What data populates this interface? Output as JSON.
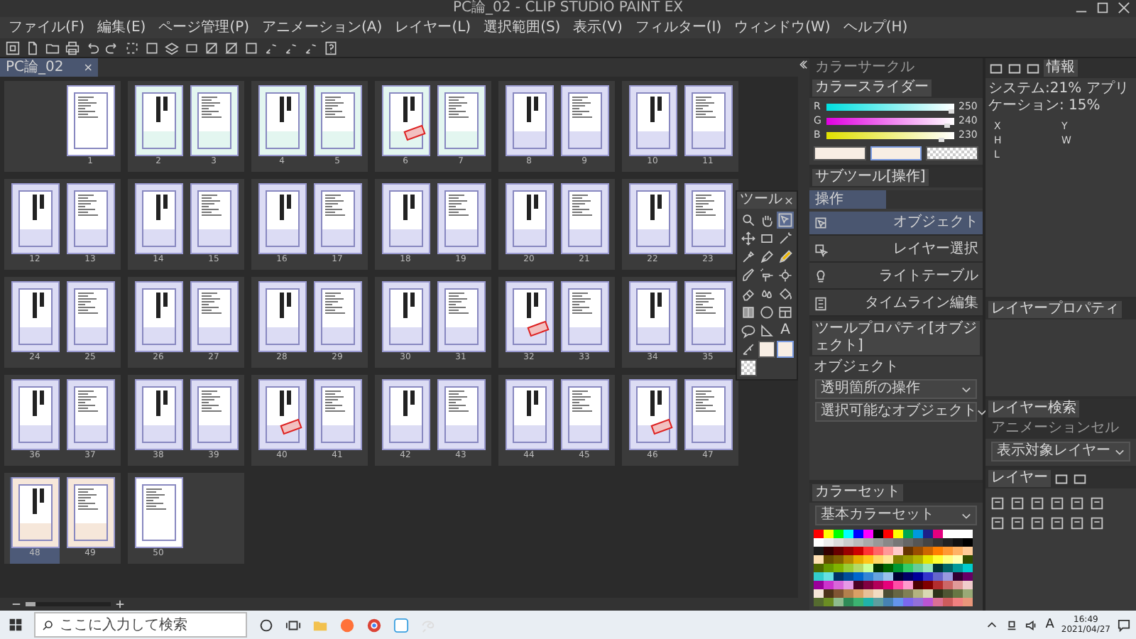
{
  "window": {
    "title": "PC論_02 - CLIP STUDIO PAINT EX"
  },
  "menu": [
    "ファイル(F)",
    "編集(E)",
    "ページ管理(P)",
    "アニメーション(A)",
    "レイヤー(L)",
    "選択範囲(S)",
    "表示(V)",
    "フィルター(I)",
    "ウィンドウ(W)",
    "ヘルプ(H)"
  ],
  "document_tab": {
    "label": "PC論_02",
    "close": "×"
  },
  "spreads": [
    {
      "pages": [
        {
          "number": "1",
          "kind": "text",
          "color": "#ffffff",
          "stamped": false,
          "selected": false
        }
      ]
    },
    {
      "pages": [
        {
          "number": "2",
          "kind": "name",
          "color": "#e3f6f0",
          "stamped": false,
          "selected": false
        },
        {
          "number": "3",
          "kind": "text",
          "color": "#e3f6f0",
          "stamped": false,
          "selected": false
        }
      ]
    },
    {
      "pages": [
        {
          "number": "4",
          "kind": "name",
          "color": "#e3f6f0",
          "stamped": false,
          "selected": false
        },
        {
          "number": "5",
          "kind": "text",
          "color": "#e3f6f0",
          "stamped": false,
          "selected": false
        }
      ]
    },
    {
      "pages": [
        {
          "number": "6",
          "kind": "name",
          "color": "#e3f6f0",
          "stamped": true,
          "selected": false
        },
        {
          "number": "7",
          "kind": "text",
          "color": "#e3f6f0",
          "stamped": false,
          "selected": false
        }
      ]
    },
    {
      "pages": [
        {
          "number": "8",
          "kind": "name",
          "color": "#dcdcf4",
          "stamped": false,
          "selected": false
        },
        {
          "number": "9",
          "kind": "text",
          "color": "#dcdcf4",
          "stamped": false,
          "selected": false
        }
      ]
    },
    {
      "pages": [
        {
          "number": "10",
          "kind": "name",
          "color": "#dcdcf4",
          "stamped": false,
          "selected": false
        },
        {
          "number": "11",
          "kind": "text",
          "color": "#dcdcf4",
          "stamped": false,
          "selected": false
        }
      ]
    },
    {
      "pages": [
        {
          "number": "12",
          "kind": "name",
          "color": "#dcdcf4",
          "stamped": false,
          "selected": false
        },
        {
          "number": "13",
          "kind": "text",
          "color": "#dcdcf4",
          "stamped": false,
          "selected": false
        }
      ]
    },
    {
      "pages": [
        {
          "number": "14",
          "kind": "name",
          "color": "#dcdcf4",
          "stamped": false,
          "selected": false
        },
        {
          "number": "15",
          "kind": "text",
          "color": "#dcdcf4",
          "stamped": false,
          "selected": false
        }
      ]
    },
    {
      "pages": [
        {
          "number": "16",
          "kind": "name",
          "color": "#dcdcf4",
          "stamped": false,
          "selected": false
        },
        {
          "number": "17",
          "kind": "text",
          "color": "#dcdcf4",
          "stamped": false,
          "selected": false
        }
      ]
    },
    {
      "pages": [
        {
          "number": "18",
          "kind": "name",
          "color": "#dcdcf4",
          "stamped": false,
          "selected": false
        },
        {
          "number": "19",
          "kind": "text",
          "color": "#dcdcf4",
          "stamped": false,
          "selected": false
        }
      ]
    },
    {
      "pages": [
        {
          "number": "20",
          "kind": "name",
          "color": "#dcdcf4",
          "stamped": false,
          "selected": false
        },
        {
          "number": "21",
          "kind": "text",
          "color": "#dcdcf4",
          "stamped": false,
          "selected": false
        }
      ]
    },
    {
      "pages": [
        {
          "number": "22",
          "kind": "name",
          "color": "#dcdcf4",
          "stamped": false,
          "selected": false
        },
        {
          "number": "23",
          "kind": "text",
          "color": "#dcdcf4",
          "stamped": false,
          "selected": false
        }
      ]
    },
    {
      "pages": [
        {
          "number": "24",
          "kind": "name",
          "color": "#dcdcf4",
          "stamped": false,
          "selected": false
        },
        {
          "number": "25",
          "kind": "text",
          "color": "#dcdcf4",
          "stamped": false,
          "selected": false
        }
      ]
    },
    {
      "pages": [
        {
          "number": "26",
          "kind": "name",
          "color": "#dcdcf4",
          "stamped": false,
          "selected": false
        },
        {
          "number": "27",
          "kind": "text",
          "color": "#dcdcf4",
          "stamped": false,
          "selected": false
        }
      ]
    },
    {
      "pages": [
        {
          "number": "28",
          "kind": "name",
          "color": "#dcdcf4",
          "stamped": false,
          "selected": false
        },
        {
          "number": "29",
          "kind": "text",
          "color": "#dcdcf4",
          "stamped": false,
          "selected": false
        }
      ]
    },
    {
      "pages": [
        {
          "number": "30",
          "kind": "name",
          "color": "#dcdcf4",
          "stamped": false,
          "selected": false
        },
        {
          "number": "31",
          "kind": "text",
          "color": "#dcdcf4",
          "stamped": false,
          "selected": false
        }
      ]
    },
    {
      "pages": [
        {
          "number": "32",
          "kind": "name",
          "color": "#dcdcf4",
          "stamped": true,
          "selected": false
        },
        {
          "number": "33",
          "kind": "text",
          "color": "#dcdcf4",
          "stamped": false,
          "selected": false
        }
      ]
    },
    {
      "pages": [
        {
          "number": "34",
          "kind": "name",
          "color": "#dcdcf4",
          "stamped": false,
          "selected": false
        },
        {
          "number": "35",
          "kind": "text",
          "color": "#dcdcf4",
          "stamped": false,
          "selected": false
        }
      ]
    },
    {
      "pages": [
        {
          "number": "36",
          "kind": "name",
          "color": "#dcdcf4",
          "stamped": false,
          "selected": false
        },
        {
          "number": "37",
          "kind": "text",
          "color": "#dcdcf4",
          "stamped": false,
          "selected": false
        }
      ]
    },
    {
      "pages": [
        {
          "number": "38",
          "kind": "name",
          "color": "#dcdcf4",
          "stamped": false,
          "selected": false
        },
        {
          "number": "39",
          "kind": "text",
          "color": "#dcdcf4",
          "stamped": false,
          "selected": false
        }
      ]
    },
    {
      "pages": [
        {
          "number": "40",
          "kind": "name",
          "color": "#dcdcf4",
          "stamped": true,
          "selected": false
        },
        {
          "number": "41",
          "kind": "text",
          "color": "#dcdcf4",
          "stamped": false,
          "selected": false
        }
      ]
    },
    {
      "pages": [
        {
          "number": "42",
          "kind": "name",
          "color": "#dcdcf4",
          "stamped": false,
          "selected": false
        },
        {
          "number": "43",
          "kind": "text",
          "color": "#dcdcf4",
          "stamped": false,
          "selected": false
        }
      ]
    },
    {
      "pages": [
        {
          "number": "44",
          "kind": "name",
          "color": "#dcdcf4",
          "stamped": false,
          "selected": false
        },
        {
          "number": "45",
          "kind": "text",
          "color": "#dcdcf4",
          "stamped": false,
          "selected": false
        }
      ]
    },
    {
      "pages": [
        {
          "number": "46",
          "kind": "name",
          "color": "#dcdcf4",
          "stamped": true,
          "selected": false
        },
        {
          "number": "47",
          "kind": "text",
          "color": "#dcdcf4",
          "stamped": false,
          "selected": false
        }
      ]
    },
    {
      "pages": [
        {
          "number": "48",
          "kind": "name",
          "color": "#f6e7da",
          "stamped": false,
          "selected": true
        },
        {
          "number": "49",
          "kind": "text",
          "color": "#f6e7da",
          "stamped": false,
          "selected": false
        }
      ]
    },
    {
      "pages": [
        {
          "number": "50",
          "kind": "text",
          "color": "#ffffff",
          "stamped": false,
          "selected": false
        }
      ]
    }
  ],
  "tool_palette": {
    "title": "ツール",
    "tools": [
      {
        "kind": "magnifier",
        "selected": false
      },
      {
        "kind": "hand",
        "selected": false
      },
      {
        "kind": "pointer-box",
        "selected": true
      },
      {
        "kind": "move-cross",
        "selected": false
      },
      {
        "kind": "rectangle",
        "selected": false
      },
      {
        "kind": "wand",
        "selected": false
      },
      {
        "kind": "eyedropper",
        "selected": false
      },
      {
        "kind": "pen",
        "selected": false
      },
      {
        "kind": "pencil",
        "selected": false
      },
      {
        "kind": "brush",
        "selected": false
      },
      {
        "kind": "airbrush",
        "selected": false
      },
      {
        "kind": "gear",
        "selected": false
      },
      {
        "kind": "eraser",
        "selected": false
      },
      {
        "kind": "drops",
        "selected": false
      },
      {
        "kind": "bucket",
        "selected": false
      },
      {
        "kind": "gradient",
        "selected": false
      },
      {
        "kind": "circle",
        "selected": false
      },
      {
        "kind": "frame",
        "selected": false
      },
      {
        "kind": "bubble",
        "selected": false
      },
      {
        "kind": "ruler",
        "selected": false
      },
      {
        "kind": "text",
        "label": "A",
        "selected": false
      },
      {
        "kind": "line-fix",
        "selected": false
      }
    ],
    "swatches": [
      {
        "kind": "color",
        "color": "#f8eee4",
        "selected": false
      },
      {
        "kind": "color",
        "color": "#f8eee4",
        "selected": true
      },
      {
        "kind": "transparent",
        "selected": false
      }
    ]
  },
  "zoom_slider": {
    "level": 0.12
  },
  "color_panel": {
    "tabs": [
      {
        "label": "カラーサークル",
        "selected": false
      },
      {
        "label": "カラースライダー",
        "selected": true
      }
    ],
    "sliders": [
      {
        "label": "R",
        "level": 0.98,
        "reading": "250"
      },
      {
        "label": "G",
        "level": 0.94,
        "reading": "240"
      },
      {
        "label": "B",
        "level": 0.9,
        "reading": "230"
      }
    ],
    "swatches": [
      {
        "kind": "color",
        "color": "#f8eee4",
        "selected": false
      },
      {
        "kind": "color",
        "color": "#f8eee4",
        "selected": true
      },
      {
        "kind": "transparent",
        "selected": false
      }
    ]
  },
  "sub_tool": {
    "title": "サブツール[操作]",
    "group": "操作",
    "items": [
      {
        "label": "オブジェクト",
        "selected": true
      },
      {
        "label": "レイヤー選択",
        "selected": false
      },
      {
        "label": "ライトテーブル",
        "selected": false
      },
      {
        "label": "タイムライン編集",
        "selected": false
      }
    ]
  },
  "tool_property": {
    "title": "ツールプロパティ[オブジェクト]",
    "heading": "オブジェクト",
    "dropdowns": [
      "透明箇所の操作",
      "選択可能なオブジェクト"
    ]
  },
  "color_set": {
    "title": "カラーセット",
    "dropdown": "基本カラーセット",
    "rows": [
      [
        {
          "color": "#ff0000"
        },
        {
          "color": "#ffff00"
        },
        {
          "color": "#00ff00"
        },
        {
          "color": "#00ffff"
        },
        {
          "color": "#0000ff"
        },
        {
          "color": "#ff00ff"
        },
        {
          "color": "#000000"
        },
        {
          "color": "#ff0000"
        },
        {
          "color": "#ffff00"
        },
        {
          "color": "#00a651"
        },
        {
          "color": "#0099dd"
        },
        {
          "color": "#1d2088"
        },
        {
          "color": "#e4007f"
        },
        {
          "color": "#ffffff"
        },
        {
          "color": "#ffffff"
        },
        {
          "color": "#ffffff"
        }
      ],
      [
        {
          "color": "#ffffff"
        },
        {
          "color": "#eeeeee"
        },
        {
          "color": "#dddddd"
        },
        {
          "color": "#cccccc"
        },
        {
          "color": "#bbbbbb"
        },
        {
          "color": "#aaaaaa"
        },
        {
          "color": "#999999"
        },
        {
          "color": "#888888"
        },
        {
          "color": "#777777"
        },
        {
          "color": "#666666"
        },
        {
          "color": "#555555"
        },
        {
          "color": "#444444"
        },
        {
          "color": "#333333"
        },
        {
          "color": "#222222"
        },
        {
          "color": "#111111"
        },
        {
          "color": "#000000"
        }
      ],
      [
        {
          "color": "#1a1a1a"
        },
        {
          "color": "#330000"
        },
        {
          "color": "#660000"
        },
        {
          "color": "#990000"
        },
        {
          "color": "#cc0000"
        },
        {
          "color": "#ff3333"
        },
        {
          "color": "#ff6666"
        },
        {
          "color": "#ff9999"
        },
        {
          "color": "#ffcccc"
        },
        {
          "color": "#663300"
        },
        {
          "color": "#994c00"
        },
        {
          "color": "#cc6600"
        },
        {
          "color": "#ff8000"
        },
        {
          "color": "#ff9933"
        },
        {
          "color": "#ffb366"
        },
        {
          "color": "#ffcc99"
        }
      ],
      [
        {
          "color": "#ffe0b3"
        },
        {
          "color": "#664d00"
        },
        {
          "color": "#806000"
        },
        {
          "color": "#b38600"
        },
        {
          "color": "#e6ac00"
        },
        {
          "color": "#ffc61a"
        },
        {
          "color": "#ffd966"
        },
        {
          "color": "#ffe699"
        },
        {
          "color": "#808000"
        },
        {
          "color": "#999900"
        },
        {
          "color": "#b3b300"
        },
        {
          "color": "#e6e600"
        },
        {
          "color": "#ffff33"
        },
        {
          "color": "#ffff80"
        },
        {
          "color": "#ffffb3"
        },
        {
          "color": "#334d00"
        }
      ],
      [
        {
          "color": "#4d6600"
        },
        {
          "color": "#669900"
        },
        {
          "color": "#80b300"
        },
        {
          "color": "#99cc33"
        },
        {
          "color": "#b3d966"
        },
        {
          "color": "#ccff99"
        },
        {
          "color": "#003300"
        },
        {
          "color": "#006600"
        },
        {
          "color": "#009933"
        },
        {
          "color": "#33cc66"
        },
        {
          "color": "#66cc99"
        },
        {
          "color": "#99e6bb"
        },
        {
          "color": "#003333"
        },
        {
          "color": "#006666"
        },
        {
          "color": "#009999"
        },
        {
          "color": "#00cccc"
        }
      ],
      [
        {
          "color": "#33cccc"
        },
        {
          "color": "#66e0e0"
        },
        {
          "color": "#003366"
        },
        {
          "color": "#004d99"
        },
        {
          "color": "#0066cc"
        },
        {
          "color": "#3385d6"
        },
        {
          "color": "#66a3e0"
        },
        {
          "color": "#99c2eb"
        },
        {
          "color": "#000033"
        },
        {
          "color": "#000066"
        },
        {
          "color": "#000099"
        },
        {
          "color": "#3333cc"
        },
        {
          "color": "#6666cc"
        },
        {
          "color": "#9999e0"
        },
        {
          "color": "#330033"
        },
        {
          "color": "#660066"
        }
      ],
      [
        {
          "color": "#990099"
        },
        {
          "color": "#cc33cc"
        },
        {
          "color": "#d966d9"
        },
        {
          "color": "#e699e6"
        },
        {
          "color": "#4d0026"
        },
        {
          "color": "#800040"
        },
        {
          "color": "#b30059"
        },
        {
          "color": "#e6007a"
        },
        {
          "color": "#ff4da6"
        },
        {
          "color": "#ff99cc"
        },
        {
          "color": "#4d0000"
        },
        {
          "color": "#800000"
        },
        {
          "color": "#b32d2d"
        },
        {
          "color": "#cc6666"
        },
        {
          "color": "#e09999"
        },
        {
          "color": "#f0cccc"
        }
      ],
      [
        {
          "color": "#f5e6d8"
        },
        {
          "color": "#4d3319"
        },
        {
          "color": "#805533"
        },
        {
          "color": "#b3804d"
        },
        {
          "color": "#d9a066"
        },
        {
          "color": "#e6c099"
        },
        {
          "color": "#f2dcc2"
        },
        {
          "color": "#4d4d33"
        },
        {
          "color": "#666644"
        },
        {
          "color": "#808055"
        },
        {
          "color": "#b3b380"
        },
        {
          "color": "#d9d9b3"
        },
        {
          "color": "#2d3319"
        },
        {
          "color": "#4d5533"
        },
        {
          "color": "#667744"
        },
        {
          "color": "#99aa77"
        }
      ],
      [
        {
          "color": "#556b2f"
        },
        {
          "color": "#6b8e23"
        },
        {
          "color": "#8fbc8f"
        },
        {
          "color": "#2e8b57"
        },
        {
          "color": "#3cb371"
        },
        {
          "color": "#20b2aa"
        },
        {
          "color": "#5f9ea0"
        },
        {
          "color": "#4682b4"
        },
        {
          "color": "#6495ed"
        },
        {
          "color": "#7b68ee"
        },
        {
          "color": "#9370db"
        },
        {
          "color": "#ba55d3"
        },
        {
          "color": "#db7093"
        },
        {
          "color": "#cd5c5c"
        },
        {
          "color": "#f08080"
        },
        {
          "color": "#e9967a"
        }
      ]
    ]
  },
  "info_panel": {
    "tabs": [
      {
        "selected": false
      },
      {
        "selected": false
      },
      {
        "selected": false
      },
      {
        "label": "情報",
        "selected": true
      }
    ],
    "usage": "システム:21% アプリケーション: 15%",
    "fields": [
      "X",
      "Y",
      "H",
      "W",
      "L"
    ]
  },
  "layer_property": {
    "title": "レイヤープロパティ"
  },
  "layer_search": {
    "tabs": [
      {
        "label": "レイヤー検索",
        "selected": true
      },
      {
        "label": "アニメーションセル",
        "selected": false
      }
    ],
    "dropdown": "表示対象レイヤー"
  },
  "layer_panel": {
    "tabs": [
      {
        "label": "レイヤー",
        "selected": true
      },
      {
        "selected": false
      },
      {
        "selected": false
      }
    ]
  },
  "taskbar": {
    "search_placeholder": "ここに入力して検索",
    "ime": "A",
    "time": "16:49",
    "date": "2021/04/27"
  }
}
